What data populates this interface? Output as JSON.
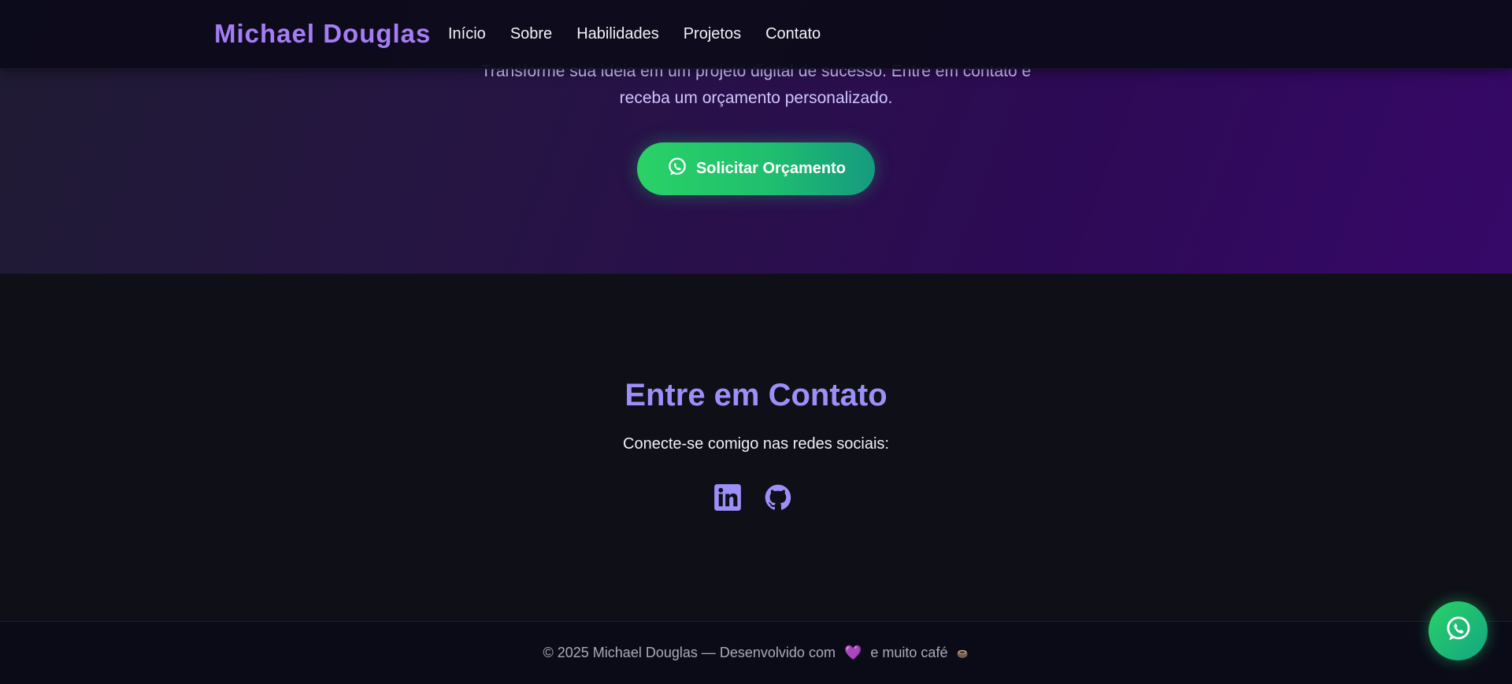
{
  "navbar": {
    "brand": "Michael Douglas",
    "links": [
      "Início",
      "Sobre",
      "Habilidades",
      "Projetos",
      "Contato"
    ]
  },
  "cta": {
    "text_line1": "Transforme sua ideia em um projeto digital de sucesso. Entre em contato e",
    "text_line2": "receba um orçamento personalizado.",
    "button_label": "Solicitar Orçamento",
    "button_icon": "whatsapp-icon"
  },
  "contact": {
    "title": "Entre em Contato",
    "subtitle": "Conecte-se comigo nas redes sociais:",
    "socials": [
      {
        "name": "LinkedIn",
        "icon": "linkedin-icon"
      },
      {
        "name": "GitHub",
        "icon": "github-icon"
      }
    ]
  },
  "footer": {
    "text_before": "© 2025 Michael Douglas — Desenvolvido com",
    "heart": "💜",
    "text_after": "e muito café"
  },
  "floating_button": {
    "icon": "whatsapp-icon"
  },
  "colors": {
    "accent": "#9c8ff8",
    "brand": "#a57ef5",
    "cta_green": "#2ad266",
    "background": "#0e0f17"
  }
}
